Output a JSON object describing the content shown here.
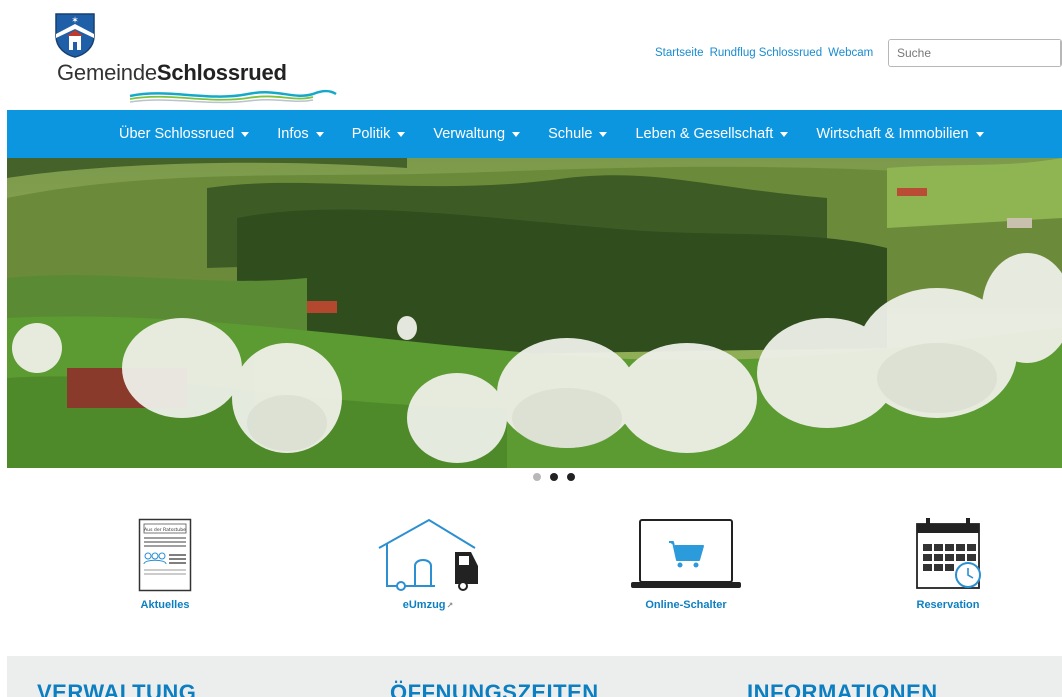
{
  "brand": {
    "name_part1": "Gemeinde",
    "name_part2": "Schlossrued"
  },
  "top_links": [
    "Startseite",
    "Rundflug Schlossrued",
    "Webcam"
  ],
  "search": {
    "placeholder": "Suche"
  },
  "nav": [
    "Über Schlossrued",
    "Infos",
    "Politik",
    "Verwaltung",
    "Schule",
    "Leben & Gesellschaft",
    "Wirtschaft & Immobilien"
  ],
  "carousel": {
    "slide_count": 3,
    "active_slide": 1
  },
  "quick_links": {
    "aktuelles": "Aktuelles",
    "aktuelles_card_heading": "Aus der Ratsstube",
    "eumzug": "eUmzug",
    "online_schalter": "Online-Schalter",
    "reservation": "Reservation"
  },
  "footer_headings": [
    "VERWALTUNG",
    "ÖFFNUNGSZEITEN",
    "INFORMATIONEN"
  ],
  "colors": {
    "primary_blue": "#0d96e0",
    "link_blue": "#1a8ccf",
    "heading_blue": "#0d7fc1",
    "footer_bg": "#eceeee"
  }
}
